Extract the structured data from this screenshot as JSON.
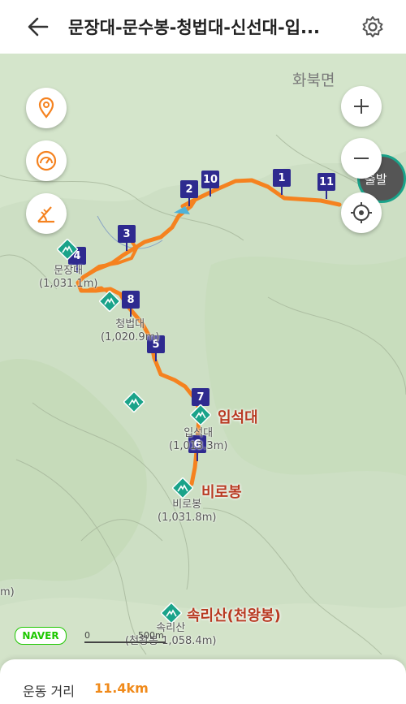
{
  "header": {
    "title": "문장대-문수봉-청법대-신선대-입...",
    "back_icon": "arrow-left-icon",
    "settings_icon": "gear-icon"
  },
  "map": {
    "area_label": "화북면",
    "route_color": "#f5821f",
    "marker_color": "#2e2a8f",
    "waypoints": [
      "1",
      "2",
      "3",
      "4",
      "5",
      "6",
      "7",
      "8",
      "10",
      "11"
    ],
    "peaks": [
      {
        "label_line1": "문장대",
        "label_line2": "(1,031.1m)"
      },
      {
        "label_line1": "청법대",
        "label_line2": "(1,020.9m)"
      },
      {
        "label_line1": "입석대",
        "label_line2": "(1,013.3m)",
        "highlight": "입석대"
      },
      {
        "label_line1": "비로봉",
        "label_line2": "(1,031.8m)",
        "highlight": "비로봉"
      },
      {
        "label_line1": "속리산",
        "label_line2": "(천왕봉 1,058.4m)",
        "highlight": "속리산(천왕봉)"
      }
    ],
    "partial_label_left": "m)",
    "start_badge_text": "출발",
    "naver_logo": "NAVER",
    "scale": {
      "zero": "0",
      "distance": "500m"
    }
  },
  "controls": {
    "location_pin_icon": "location-pin-icon",
    "speed_icon": "gauge-icon",
    "slope_icon": "slope-icon",
    "zoom_in_icon": "plus-icon",
    "zoom_out_icon": "minus-icon",
    "current_location_icon": "crosshair-icon"
  },
  "summary": {
    "distance_label": "운동 거리",
    "distance_value": "11.4km"
  }
}
